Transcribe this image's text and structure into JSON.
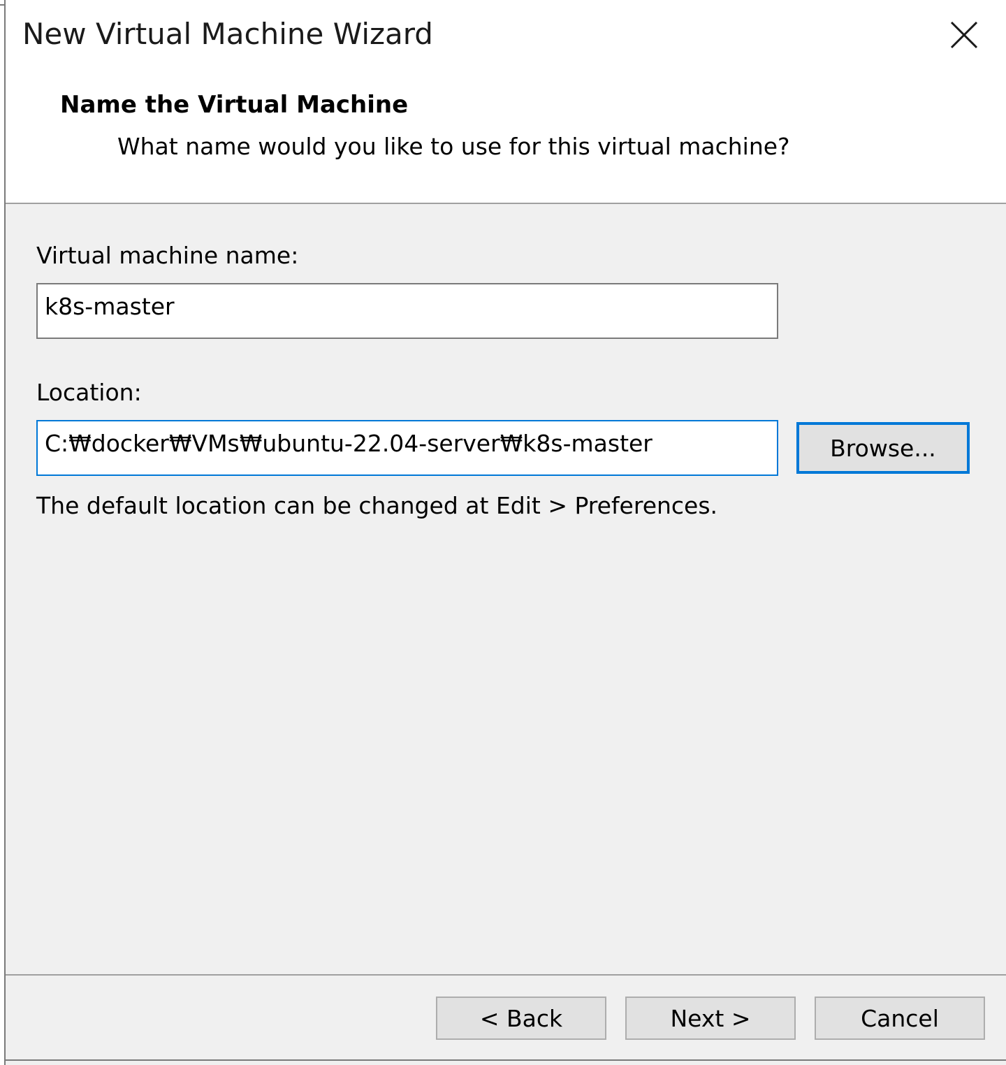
{
  "window": {
    "title": "New Virtual Machine Wizard",
    "close_icon": "close-icon"
  },
  "header": {
    "title": "Name the Virtual Machine",
    "subtitle": "What name would you like to use for this virtual machine?"
  },
  "form": {
    "vm_name_label": "Virtual machine name:",
    "vm_name_value": "k8s-master",
    "location_label": "Location:",
    "location_value": "C:₩docker₩VMs₩ubuntu-22.04-server₩k8s-master",
    "browse_label": "Browse...",
    "hint": "The default location can be changed at Edit > Preferences."
  },
  "footer": {
    "back_label": "< Back",
    "next_label": "Next >",
    "cancel_label": "Cancel"
  },
  "colors": {
    "focus_accent": "#0078d7",
    "panel_background": "#f0f0f0",
    "button_face": "#e1e1e1"
  }
}
